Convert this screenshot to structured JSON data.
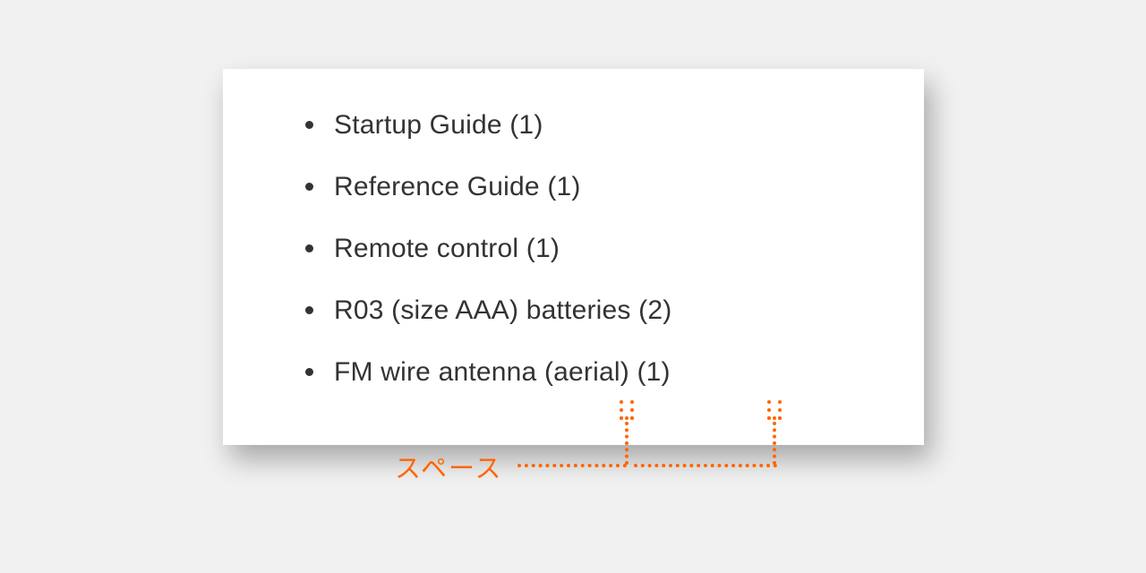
{
  "list": {
    "items": [
      "Startup Guide (1)",
      "Reference Guide (1)",
      "Remote control (1)",
      "R03 (size AAA) batteries (2)",
      "FM wire antenna (aerial) (1)"
    ]
  },
  "annotation": {
    "label": "スペース",
    "accent_color": "#ff6600"
  }
}
